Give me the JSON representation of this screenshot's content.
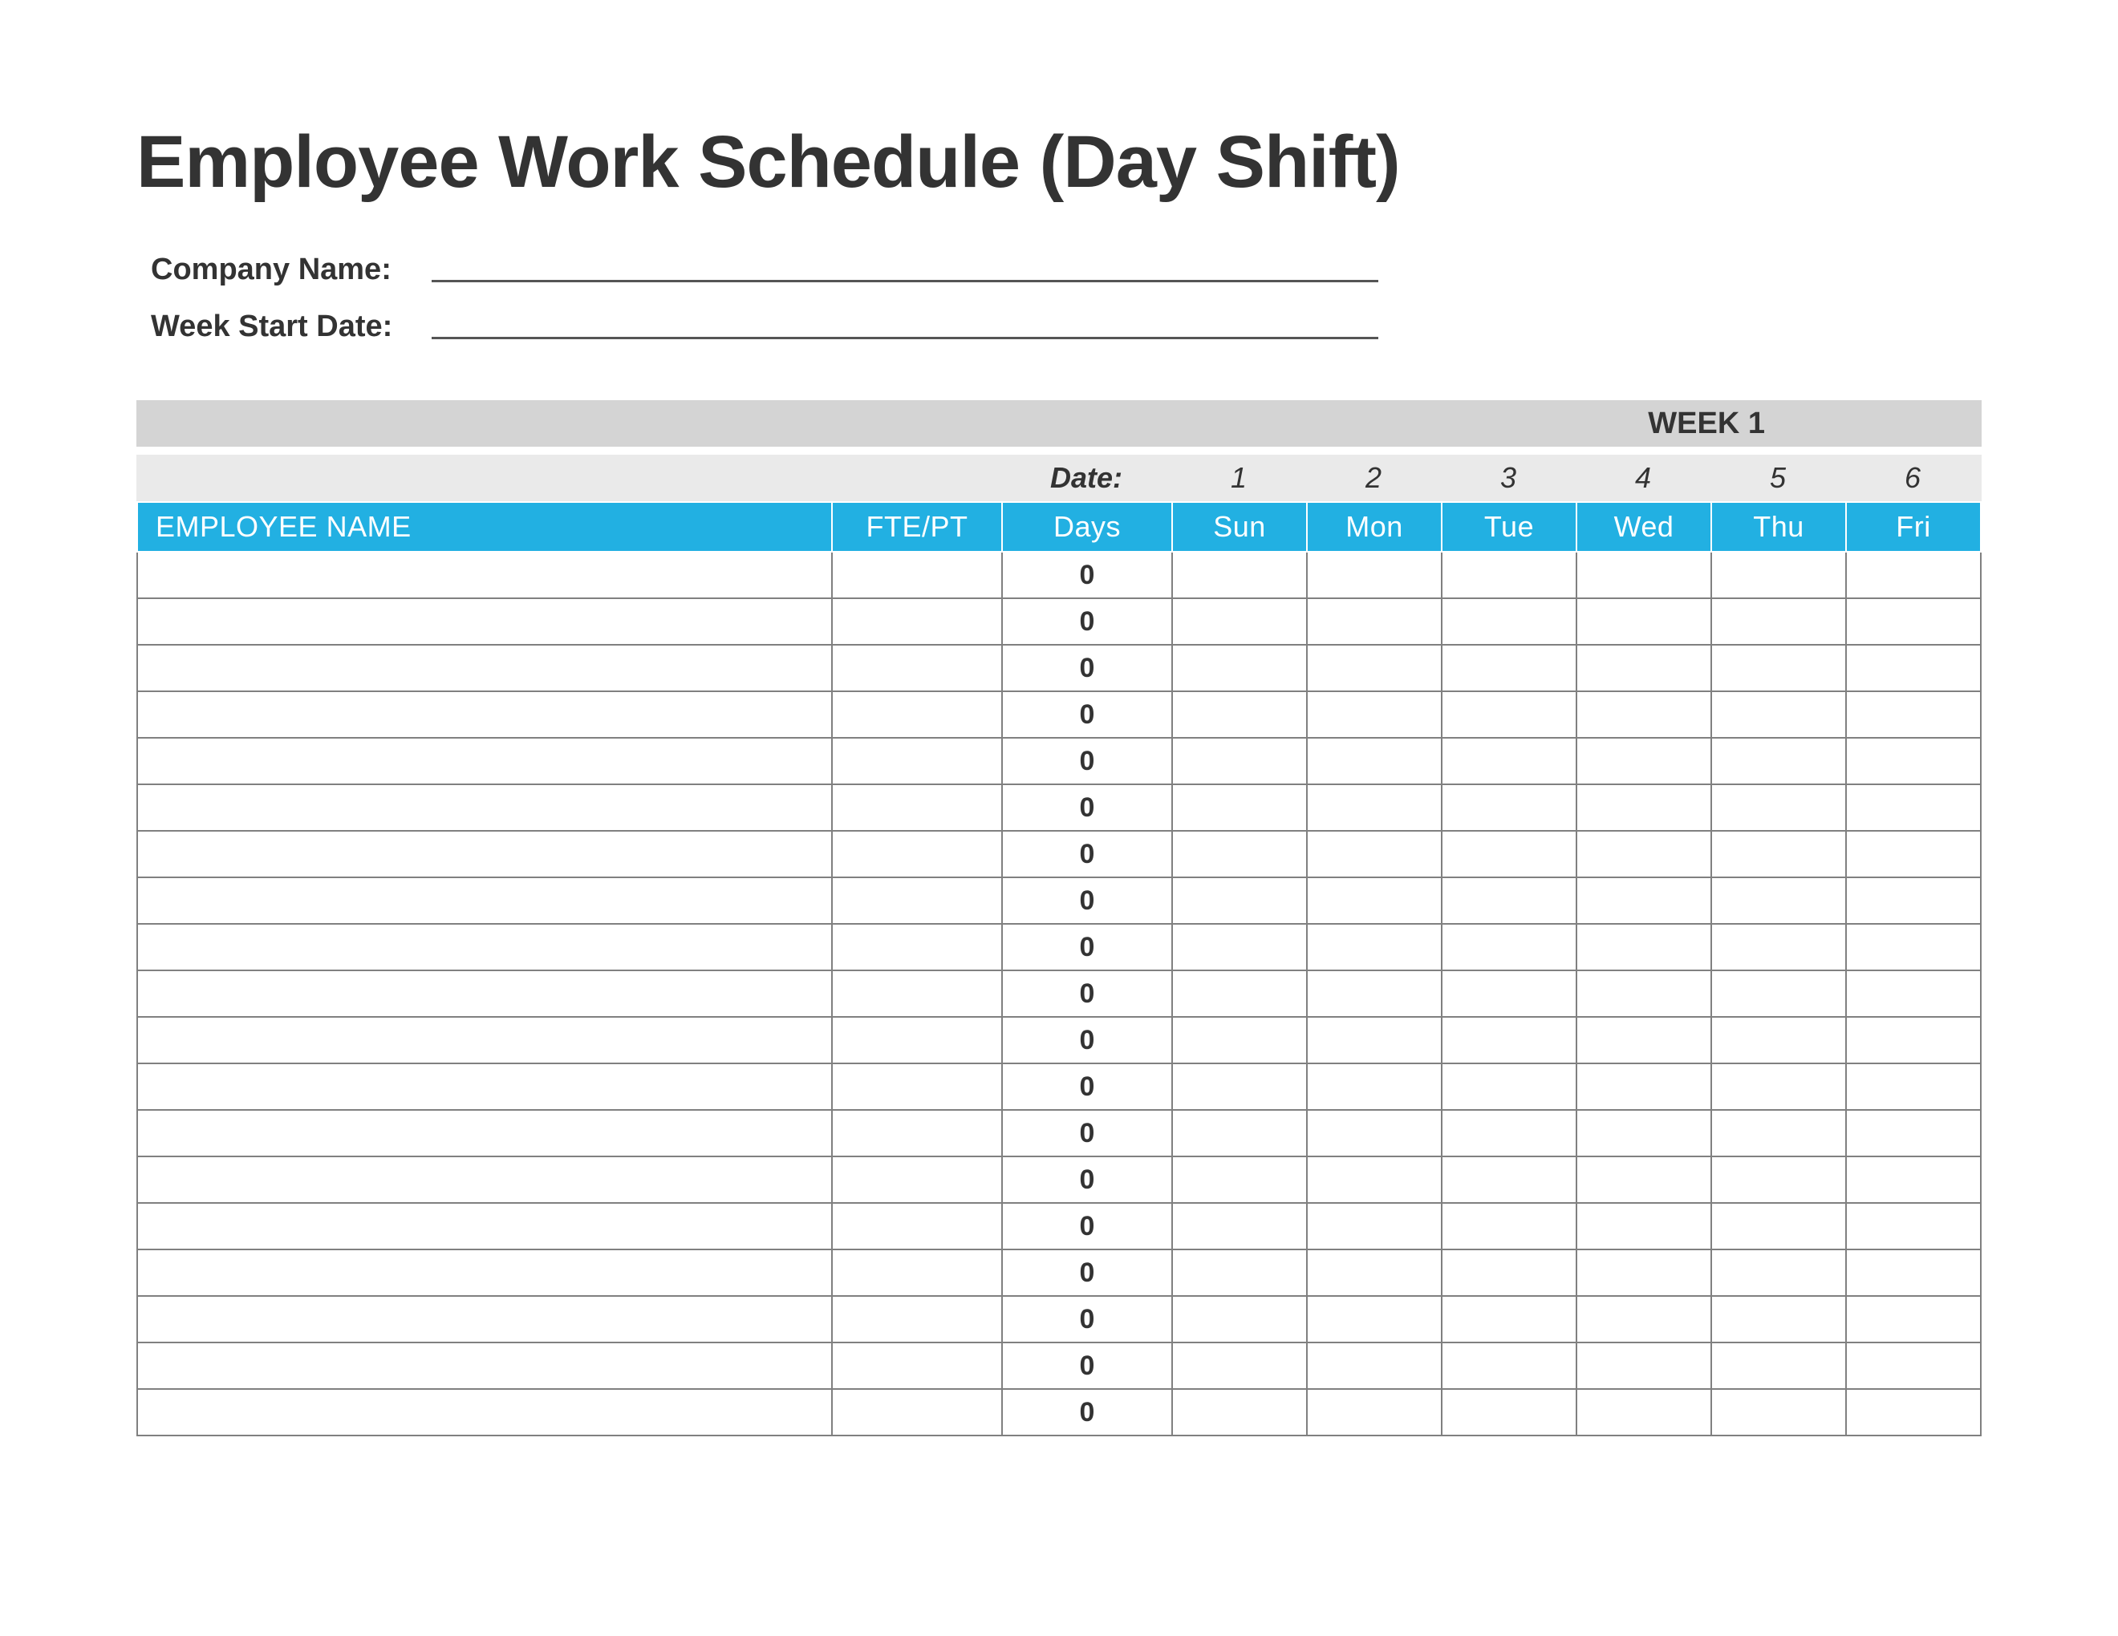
{
  "title": "Employee Work Schedule (Day Shift)",
  "meta": {
    "company_label": "Company Name:",
    "company_value": "",
    "week_start_label": "Week Start Date:",
    "week_start_value": ""
  },
  "week_bar": "WEEK 1",
  "date_bar": {
    "label": "Date:",
    "numbers": [
      "1",
      "2",
      "3",
      "4",
      "5",
      "6"
    ]
  },
  "columns": {
    "employee": "EMPLOYEE NAME",
    "fte": "FTE/PT",
    "days": "Days",
    "dayheads": [
      "Sun",
      "Mon",
      "Tue",
      "Wed",
      "Thu",
      "Fri"
    ]
  },
  "rows": [
    {
      "name": "",
      "fte": "",
      "days": "0",
      "d": [
        "",
        "",
        "",
        "",
        "",
        ""
      ]
    },
    {
      "name": "",
      "fte": "",
      "days": "0",
      "d": [
        "",
        "",
        "",
        "",
        "",
        ""
      ]
    },
    {
      "name": "",
      "fte": "",
      "days": "0",
      "d": [
        "",
        "",
        "",
        "",
        "",
        ""
      ]
    },
    {
      "name": "",
      "fte": "",
      "days": "0",
      "d": [
        "",
        "",
        "",
        "",
        "",
        ""
      ]
    },
    {
      "name": "",
      "fte": "",
      "days": "0",
      "d": [
        "",
        "",
        "",
        "",
        "",
        ""
      ]
    },
    {
      "name": "",
      "fte": "",
      "days": "0",
      "d": [
        "",
        "",
        "",
        "",
        "",
        ""
      ]
    },
    {
      "name": "",
      "fte": "",
      "days": "0",
      "d": [
        "",
        "",
        "",
        "",
        "",
        ""
      ]
    },
    {
      "name": "",
      "fte": "",
      "days": "0",
      "d": [
        "",
        "",
        "",
        "",
        "",
        ""
      ]
    },
    {
      "name": "",
      "fte": "",
      "days": "0",
      "d": [
        "",
        "",
        "",
        "",
        "",
        ""
      ]
    },
    {
      "name": "",
      "fte": "",
      "days": "0",
      "d": [
        "",
        "",
        "",
        "",
        "",
        ""
      ]
    },
    {
      "name": "",
      "fte": "",
      "days": "0",
      "d": [
        "",
        "",
        "",
        "",
        "",
        ""
      ]
    },
    {
      "name": "",
      "fte": "",
      "days": "0",
      "d": [
        "",
        "",
        "",
        "",
        "",
        ""
      ]
    },
    {
      "name": "",
      "fte": "",
      "days": "0",
      "d": [
        "",
        "",
        "",
        "",
        "",
        ""
      ]
    },
    {
      "name": "",
      "fte": "",
      "days": "0",
      "d": [
        "",
        "",
        "",
        "",
        "",
        ""
      ]
    },
    {
      "name": "",
      "fte": "",
      "days": "0",
      "d": [
        "",
        "",
        "",
        "",
        "",
        ""
      ]
    },
    {
      "name": "",
      "fte": "",
      "days": "0",
      "d": [
        "",
        "",
        "",
        "",
        "",
        ""
      ]
    },
    {
      "name": "",
      "fte": "",
      "days": "0",
      "d": [
        "",
        "",
        "",
        "",
        "",
        ""
      ]
    },
    {
      "name": "",
      "fte": "",
      "days": "0",
      "d": [
        "",
        "",
        "",
        "",
        "",
        ""
      ]
    },
    {
      "name": "",
      "fte": "",
      "days": "0",
      "d": [
        "",
        "",
        "",
        "",
        "",
        ""
      ]
    }
  ]
}
